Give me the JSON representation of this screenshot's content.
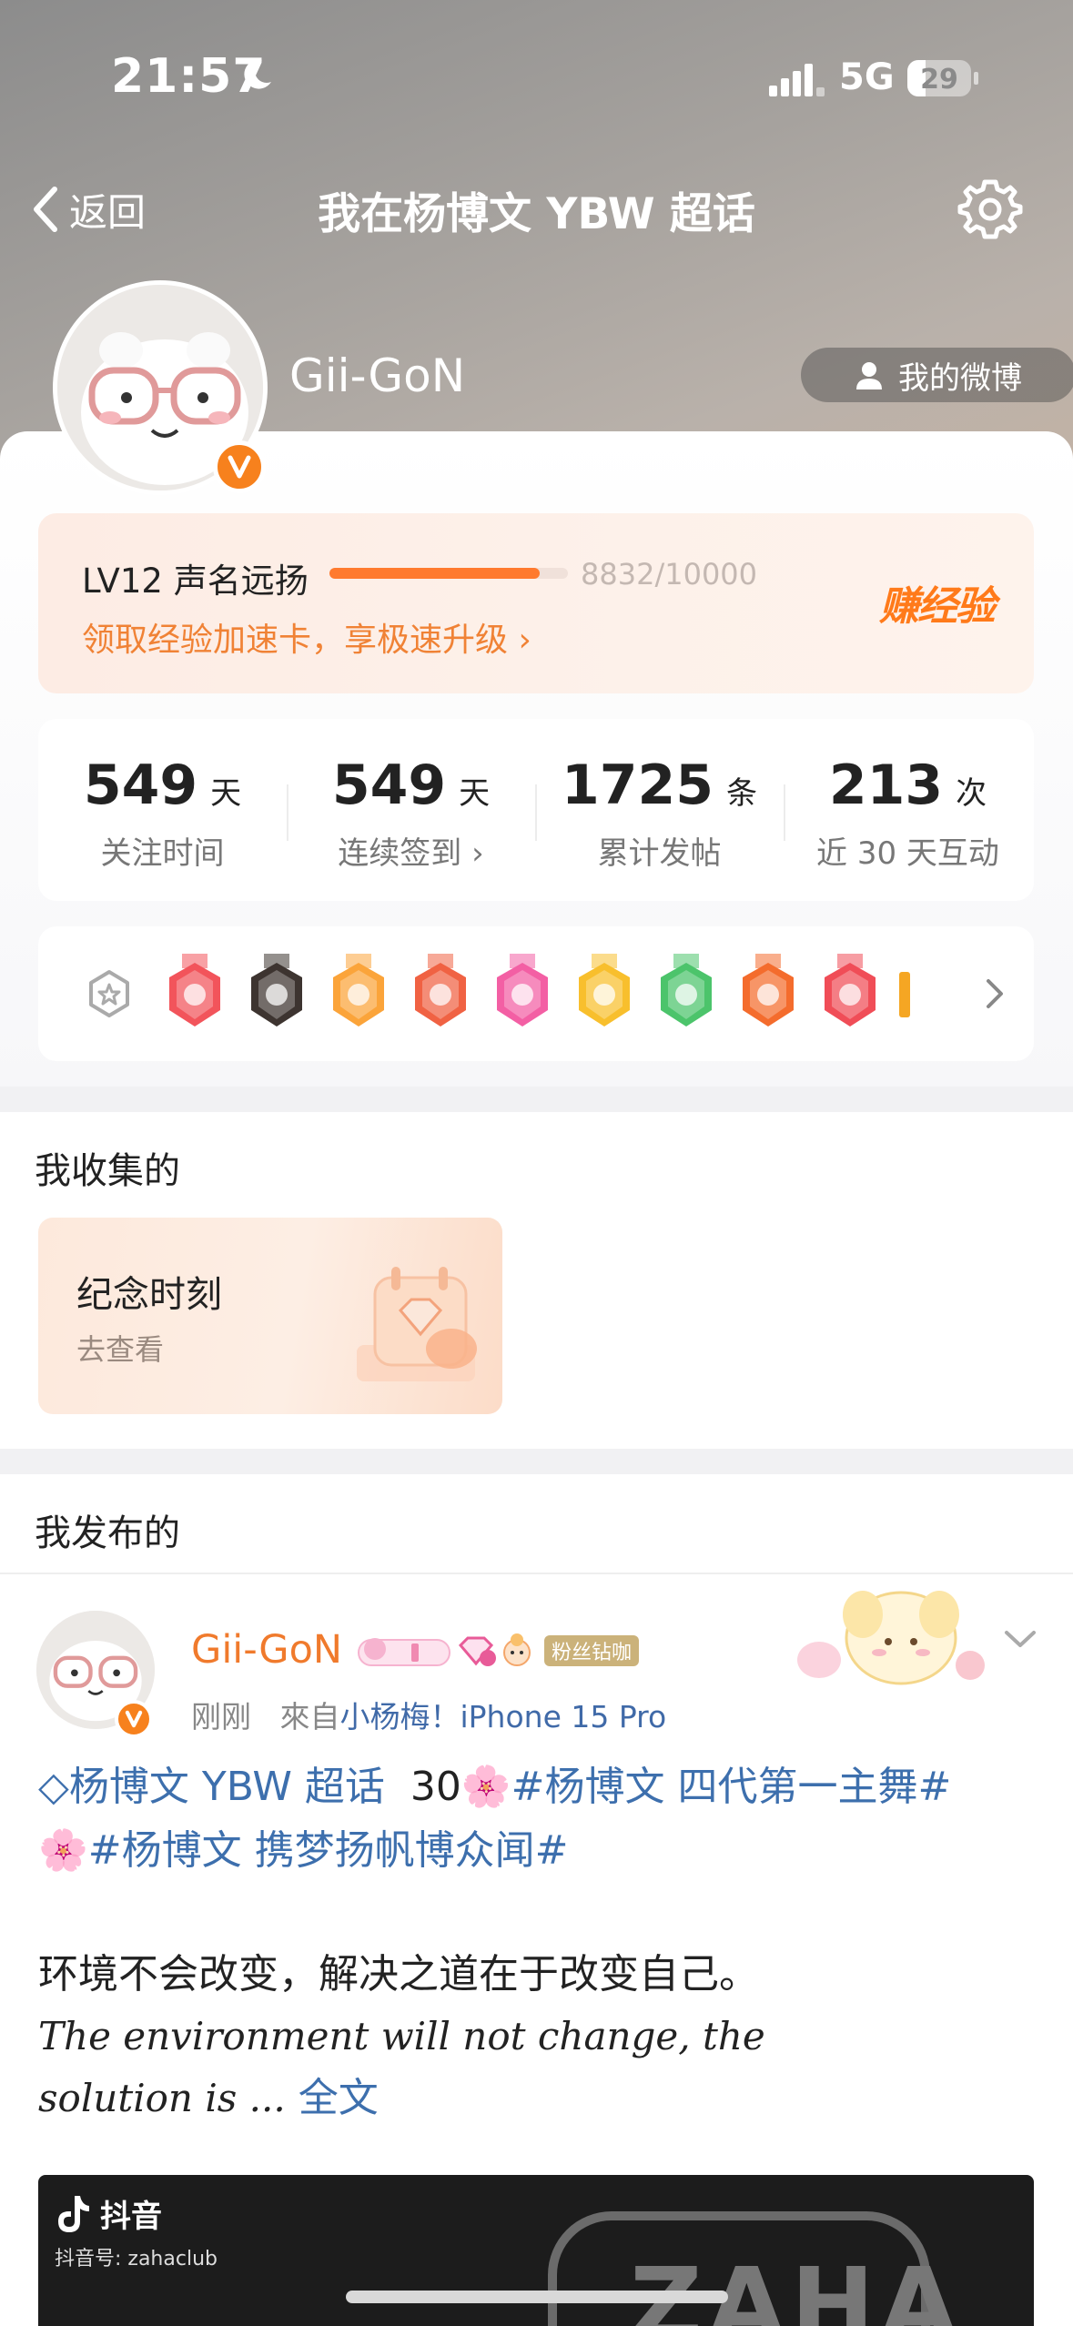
{
  "status_bar": {
    "time": "21:57",
    "network": "5G",
    "battery": "29",
    "battery_level": 0.29
  },
  "nav": {
    "back_label": "返回",
    "title": "我在杨博文 YBW 超话"
  },
  "profile": {
    "username": "Gii-GoN",
    "my_weibo_label": "我的微博"
  },
  "level": {
    "label": "LV12 声名远扬",
    "exp": "8832/10000",
    "progress": 0.8832,
    "link": "领取经验加速卡，享极速升级 ›",
    "earn_label": "赚经验"
  },
  "stats": [
    {
      "num": "549",
      "unit": "天",
      "label": "关注时间"
    },
    {
      "num": "549",
      "unit": "天",
      "label": "连续签到 ›"
    },
    {
      "num": "1725",
      "unit": "条",
      "label": "累计发帖"
    },
    {
      "num": "213",
      "unit": "次",
      "label": "近 30 天互动"
    }
  ],
  "badge_medals": [
    {
      "icon": "chick-medal-icon",
      "color": "#f2545b"
    },
    {
      "icon": "super-medal-icon",
      "color": "#3d3430"
    },
    {
      "icon": "crown-medal-icon",
      "color": "#fba43a"
    },
    {
      "icon": "lion-medal-icon",
      "color": "#f06243"
    },
    {
      "icon": "lv12-medal-icon",
      "color": "#f35fa4"
    },
    {
      "icon": "heart-medal-icon",
      "color": "#f8bf2d"
    },
    {
      "icon": "hand-medal-icon",
      "color": "#4cc46b"
    },
    {
      "icon": "days-100-medal-icon",
      "color": "#f46c2d"
    },
    {
      "icon": "trophy-medal-icon",
      "color": "#f04d57"
    }
  ],
  "collected": {
    "section_title": "我收集的",
    "card_title": "纪念时刻",
    "card_sub": "去查看"
  },
  "posted": {
    "section_title": "我发布的"
  },
  "post": {
    "author": "Gii-GoN",
    "fan_tag": "粉丝钻咖",
    "time": "刚刚",
    "from_label": "來自",
    "source": "小杨梅！iPhone 15 Pro",
    "line1_topic1": "杨博文 YBW 超话",
    "line1_plain": "30",
    "line1_topic2": "#杨博文 四代第一主舞#",
    "line2_topic": "#杨博文 携梦扬帆博众闻#",
    "body_cn": "环境不会改变，解决之道在于改变自己。",
    "body_en_1": "The environment will not change, the",
    "body_en_2": "solution is ...",
    "full_text": "全文"
  },
  "video": {
    "app": "抖音",
    "id": "抖音号: zahaclub",
    "logo": "ZAHA"
  },
  "colors": {
    "accent": "#f7811d",
    "topic": "#3d6fad",
    "progress": "#ff7a2e"
  }
}
